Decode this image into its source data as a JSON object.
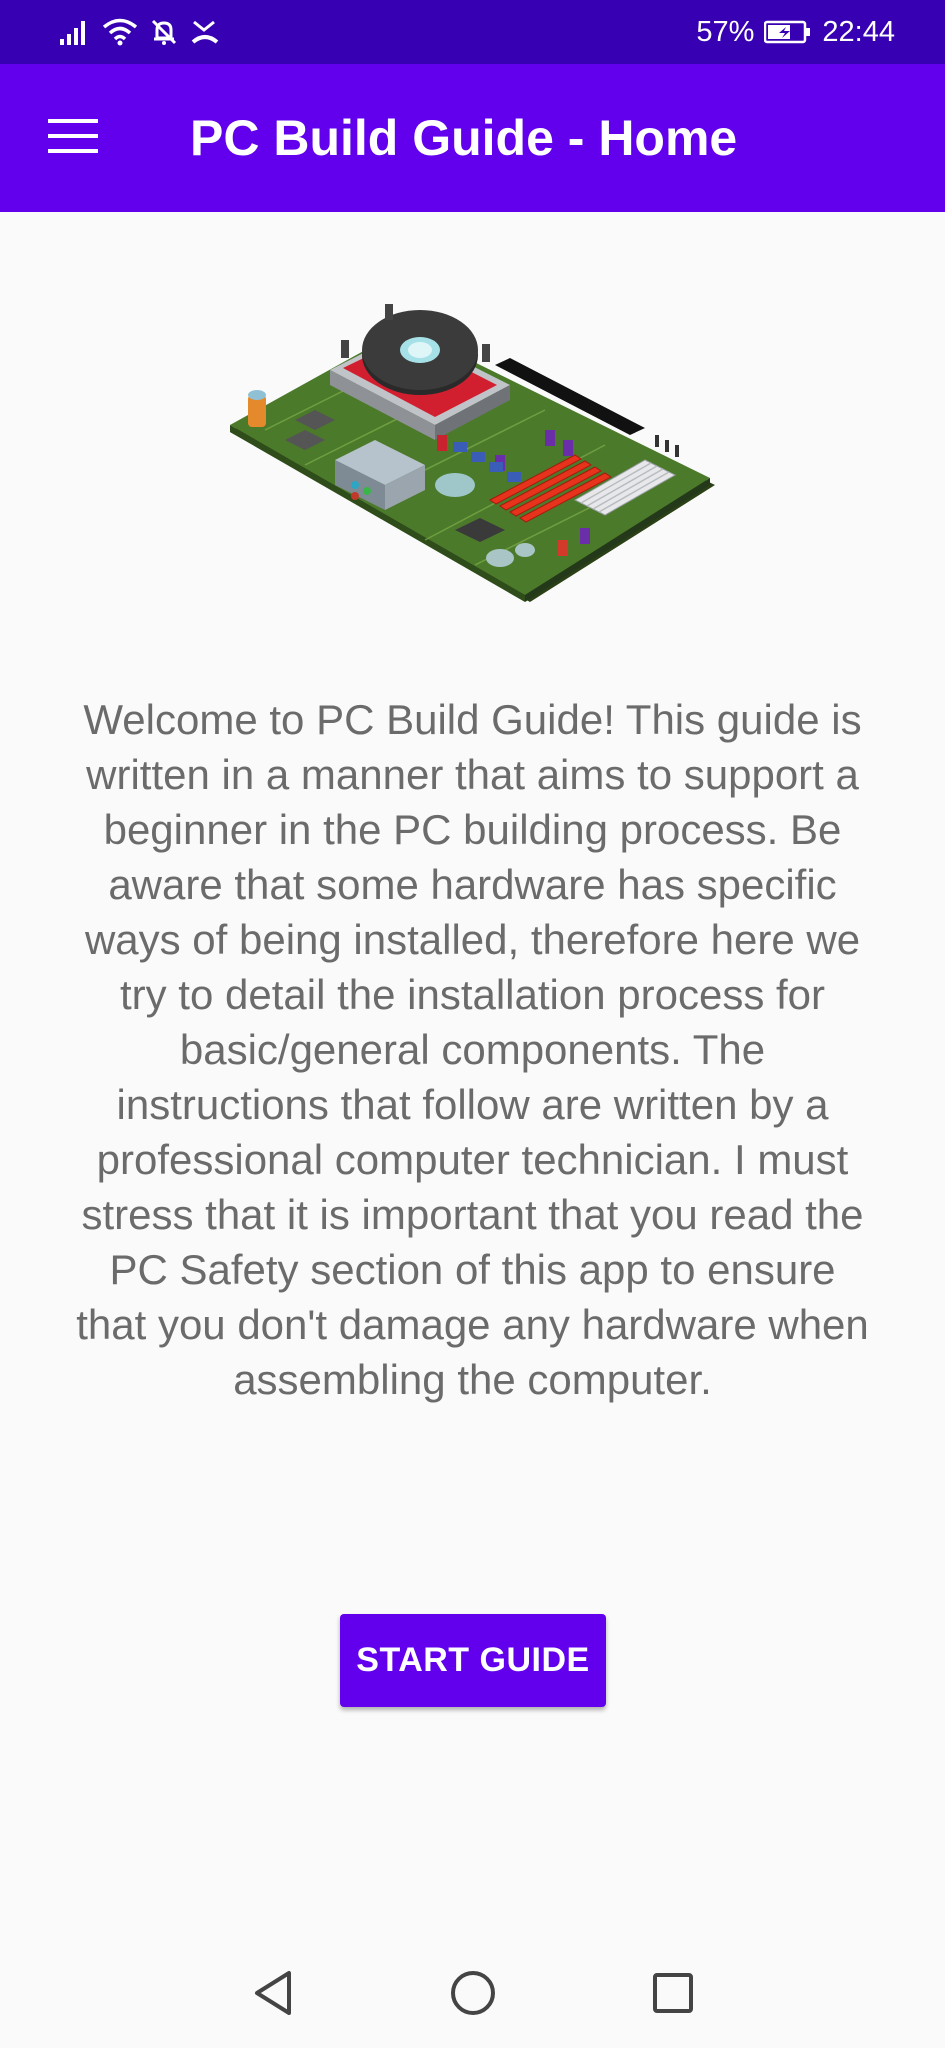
{
  "status_bar": {
    "battery_percent": "57%",
    "time": "22:44",
    "icons": [
      "signal-icon",
      "wifi-icon",
      "bell-off-icon",
      "missed-call-icon",
      "battery-charging-icon"
    ]
  },
  "app_bar": {
    "title": "PC Build Guide - Home",
    "menu_icon": "hamburger-menu-icon"
  },
  "hero_image": "motherboard-illustration",
  "welcome_text": "Welcome to PC Build Guide! This guide is written in a manner that aims to support a beginner in the PC building process. Be aware that some hardware has specific ways of being installed, therefore here we try to detail the installation process for basic/general components. The instructions that follow are written by a professional computer technician. I must stress that it is important that you read the PC Safety section of this app to ensure that you don't damage any hardware when assembling the computer.",
  "start_button_label": "START GUIDE",
  "nav_bar": {
    "icons": [
      "back-icon",
      "home-icon",
      "recents-icon"
    ]
  },
  "colors": {
    "status_bar": "#3700b3",
    "primary": "#6200ee",
    "background": "#fafafa",
    "body_text": "#6b6b6b"
  }
}
